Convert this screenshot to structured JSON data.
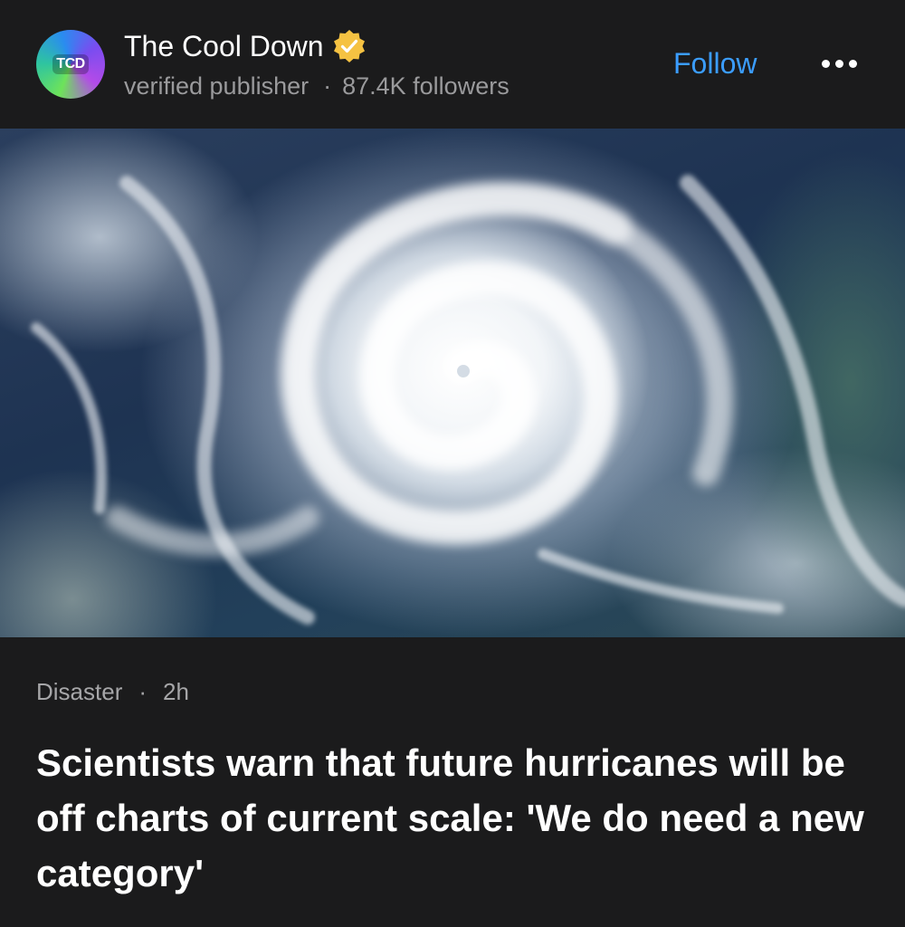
{
  "publisher": {
    "avatar_text": "TCD",
    "name": "The Cool Down",
    "verified_label": "verified publisher",
    "separator": "·",
    "followers": "87.4K followers",
    "follow_label": "Follow"
  },
  "article": {
    "category": "Disaster",
    "separator": "·",
    "age": "2h",
    "headline": "Scientists warn that future hurricanes will be off charts of current scale: 'We do need a new category'"
  },
  "colors": {
    "background": "#1b1b1c",
    "follow": "#3b9dff",
    "badge": "#f5c242",
    "muted": "#9a9a9c"
  },
  "icons": {
    "verified": "verified-badge-icon",
    "more": "more-horizontal-icon"
  }
}
